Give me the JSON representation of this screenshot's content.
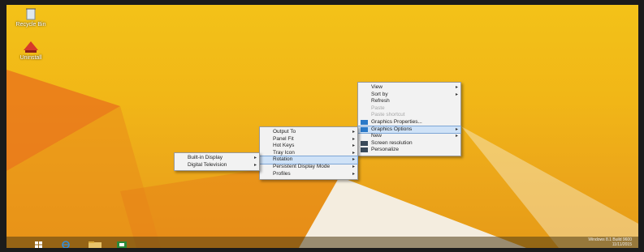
{
  "desktop": {
    "icons": [
      {
        "label": "Recycle Bin",
        "icon": "recycle-bin-icon"
      },
      {
        "label": "Uninstall",
        "icon": "application-icon"
      }
    ]
  },
  "menus": {
    "desktop_menu": [
      {
        "label": "View",
        "submenu": true
      },
      {
        "label": "Sort by",
        "submenu": true
      },
      {
        "label": "Refresh"
      },
      {
        "label": "Paste",
        "disabled": true
      },
      {
        "label": "Paste shortcut",
        "disabled": true
      },
      {
        "label": "Graphics Properties...",
        "icon": "intel-graphics-icon"
      },
      {
        "label": "Graphics Options",
        "icon": "intel-graphics-icon",
        "submenu": true,
        "highlighted": true
      },
      {
        "label": "New",
        "submenu": true
      },
      {
        "label": "Screen resolution",
        "icon": "display-icon"
      },
      {
        "label": "Personalize",
        "icon": "personalize-icon"
      }
    ],
    "graphics_options_menu": [
      {
        "label": "Output To",
        "submenu": true
      },
      {
        "label": "Panel Fit",
        "submenu": true
      },
      {
        "label": "Hot Keys",
        "submenu": true
      },
      {
        "label": "Tray Icon",
        "submenu": true
      },
      {
        "label": "Rotation",
        "submenu": true,
        "highlighted": true
      },
      {
        "label": "Persistent Display Mode",
        "submenu": true
      },
      {
        "label": "Profiles",
        "submenu": true
      }
    ],
    "output_menu": [
      {
        "label": "Built-in Display",
        "submenu": true
      },
      {
        "label": "Digital Television",
        "submenu": true
      }
    ]
  },
  "taskbar": {
    "items": [
      "start-button-icon",
      "internet-explorer-icon",
      "file-explorer-icon",
      "store-icon"
    ],
    "clock_line1": "Windows 8.1 Build 9600",
    "clock_line2": "11/11/2015"
  },
  "colors": {
    "wallpaper": "#f2bb18",
    "menu_highlight": "#cfe2f7",
    "accent": "#2b79c8"
  }
}
